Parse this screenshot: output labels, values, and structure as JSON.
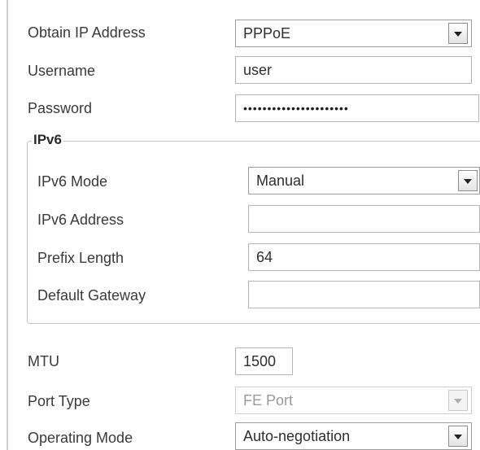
{
  "form": {
    "obtain_ip": {
      "label": "Obtain IP Address",
      "value": "PPPoE"
    },
    "username": {
      "label": "Username",
      "value": "user"
    },
    "password": {
      "label": "Password",
      "value": "••••••••••••••••••••••"
    },
    "ipv6": {
      "legend": "IPv6",
      "mode": {
        "label": "IPv6 Mode",
        "value": "Manual"
      },
      "address": {
        "label": "IPv6 Address",
        "value": ""
      },
      "prefix_length": {
        "label": "Prefix Length",
        "value": "64"
      },
      "default_gateway": {
        "label": "Default Gateway",
        "value": ""
      }
    },
    "mtu": {
      "label": "MTU",
      "value": "1500"
    },
    "port_type": {
      "label": "Port Type",
      "value": "FE Port",
      "disabled": true
    },
    "operating_mode": {
      "label": "Operating Mode",
      "value": "Auto-negotiation"
    }
  },
  "icons": {
    "dropdown": "chevron-down-icon"
  }
}
